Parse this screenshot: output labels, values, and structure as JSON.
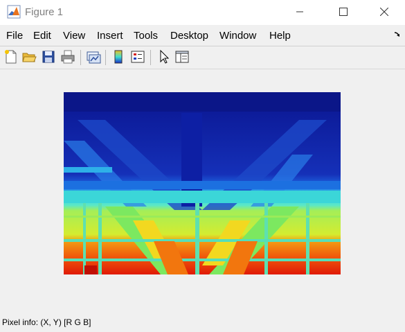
{
  "window": {
    "title": "Figure 1",
    "controls": [
      "minimize-icon",
      "maximize-icon",
      "close-icon"
    ]
  },
  "menu": {
    "items": [
      "File",
      "Edit",
      "View",
      "Insert",
      "Tools",
      "Desktop",
      "Window",
      "Help"
    ],
    "overflow_icon": "arrow-icon"
  },
  "toolbar": {
    "buttons": [
      "new-figure-icon",
      "open-file-icon",
      "save-icon",
      "print-icon",
      "link-plot-icon",
      "insert-colorbar-icon",
      "insert-legend-icon",
      "pointer-icon",
      "property-inspector-icon"
    ]
  },
  "image": {
    "description_colors": {
      "far": "#0c1a9a",
      "mid": "#1a5adf",
      "near_teal": "#3fe0d0",
      "near_green": "#a6f05a",
      "closest": "#e62a0a"
    }
  },
  "status": {
    "pixel_info": "Pixel info: (X, Y)  [R G B]"
  }
}
